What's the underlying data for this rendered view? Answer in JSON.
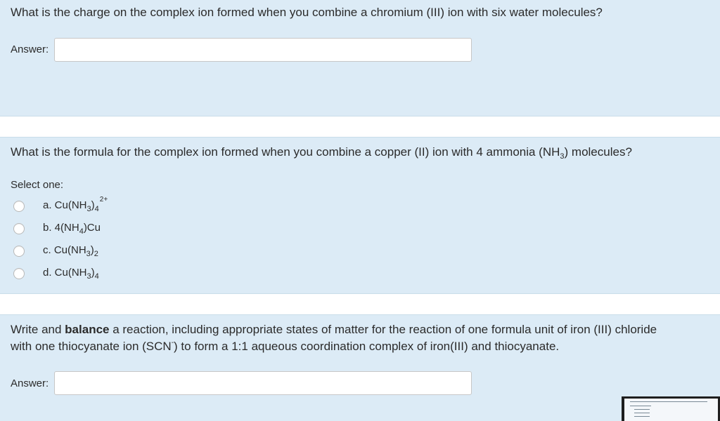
{
  "question1": {
    "text": "What is the charge on the complex ion formed when you combine a chromium (III) ion with six water molecules?",
    "answer_label": "Answer:",
    "answer_value": ""
  },
  "question2": {
    "text_pre": "What is the formula for the complex ion formed when you combine a copper (II) ion with 4 ammonia (NH",
    "text_sub": "3",
    "text_post": ") molecules?",
    "select_label": "Select one:",
    "options": [
      {
        "prefix": "a. Cu(NH",
        "sub1": "3",
        "mid": ")",
        "sub2": "4",
        "sup": "2+"
      },
      {
        "prefix": "b. 4(NH",
        "sub1": "4",
        "mid": ")Cu",
        "sub2": "",
        "sup": ""
      },
      {
        "prefix": "c. Cu(NH",
        "sub1": "3",
        "mid": ")",
        "sub2": "2",
        "sup": ""
      },
      {
        "prefix": "d. Cu(NH",
        "sub1": "3",
        "mid": ")",
        "sub2": "4",
        "sup": ""
      }
    ]
  },
  "question3": {
    "text_a": "Write and ",
    "text_bold": "balance",
    "text_b": " a reaction, including appropriate states of matter for the reaction of one formula unit of iron (III) chloride",
    "text_c": "with one thiocyanate ion (SCN",
    "text_sup": "-",
    "text_d": ") to form a 1:1 aqueous coordination complex of iron(III) and thiocyanate.",
    "answer_label": "Answer:",
    "answer_value": ""
  }
}
